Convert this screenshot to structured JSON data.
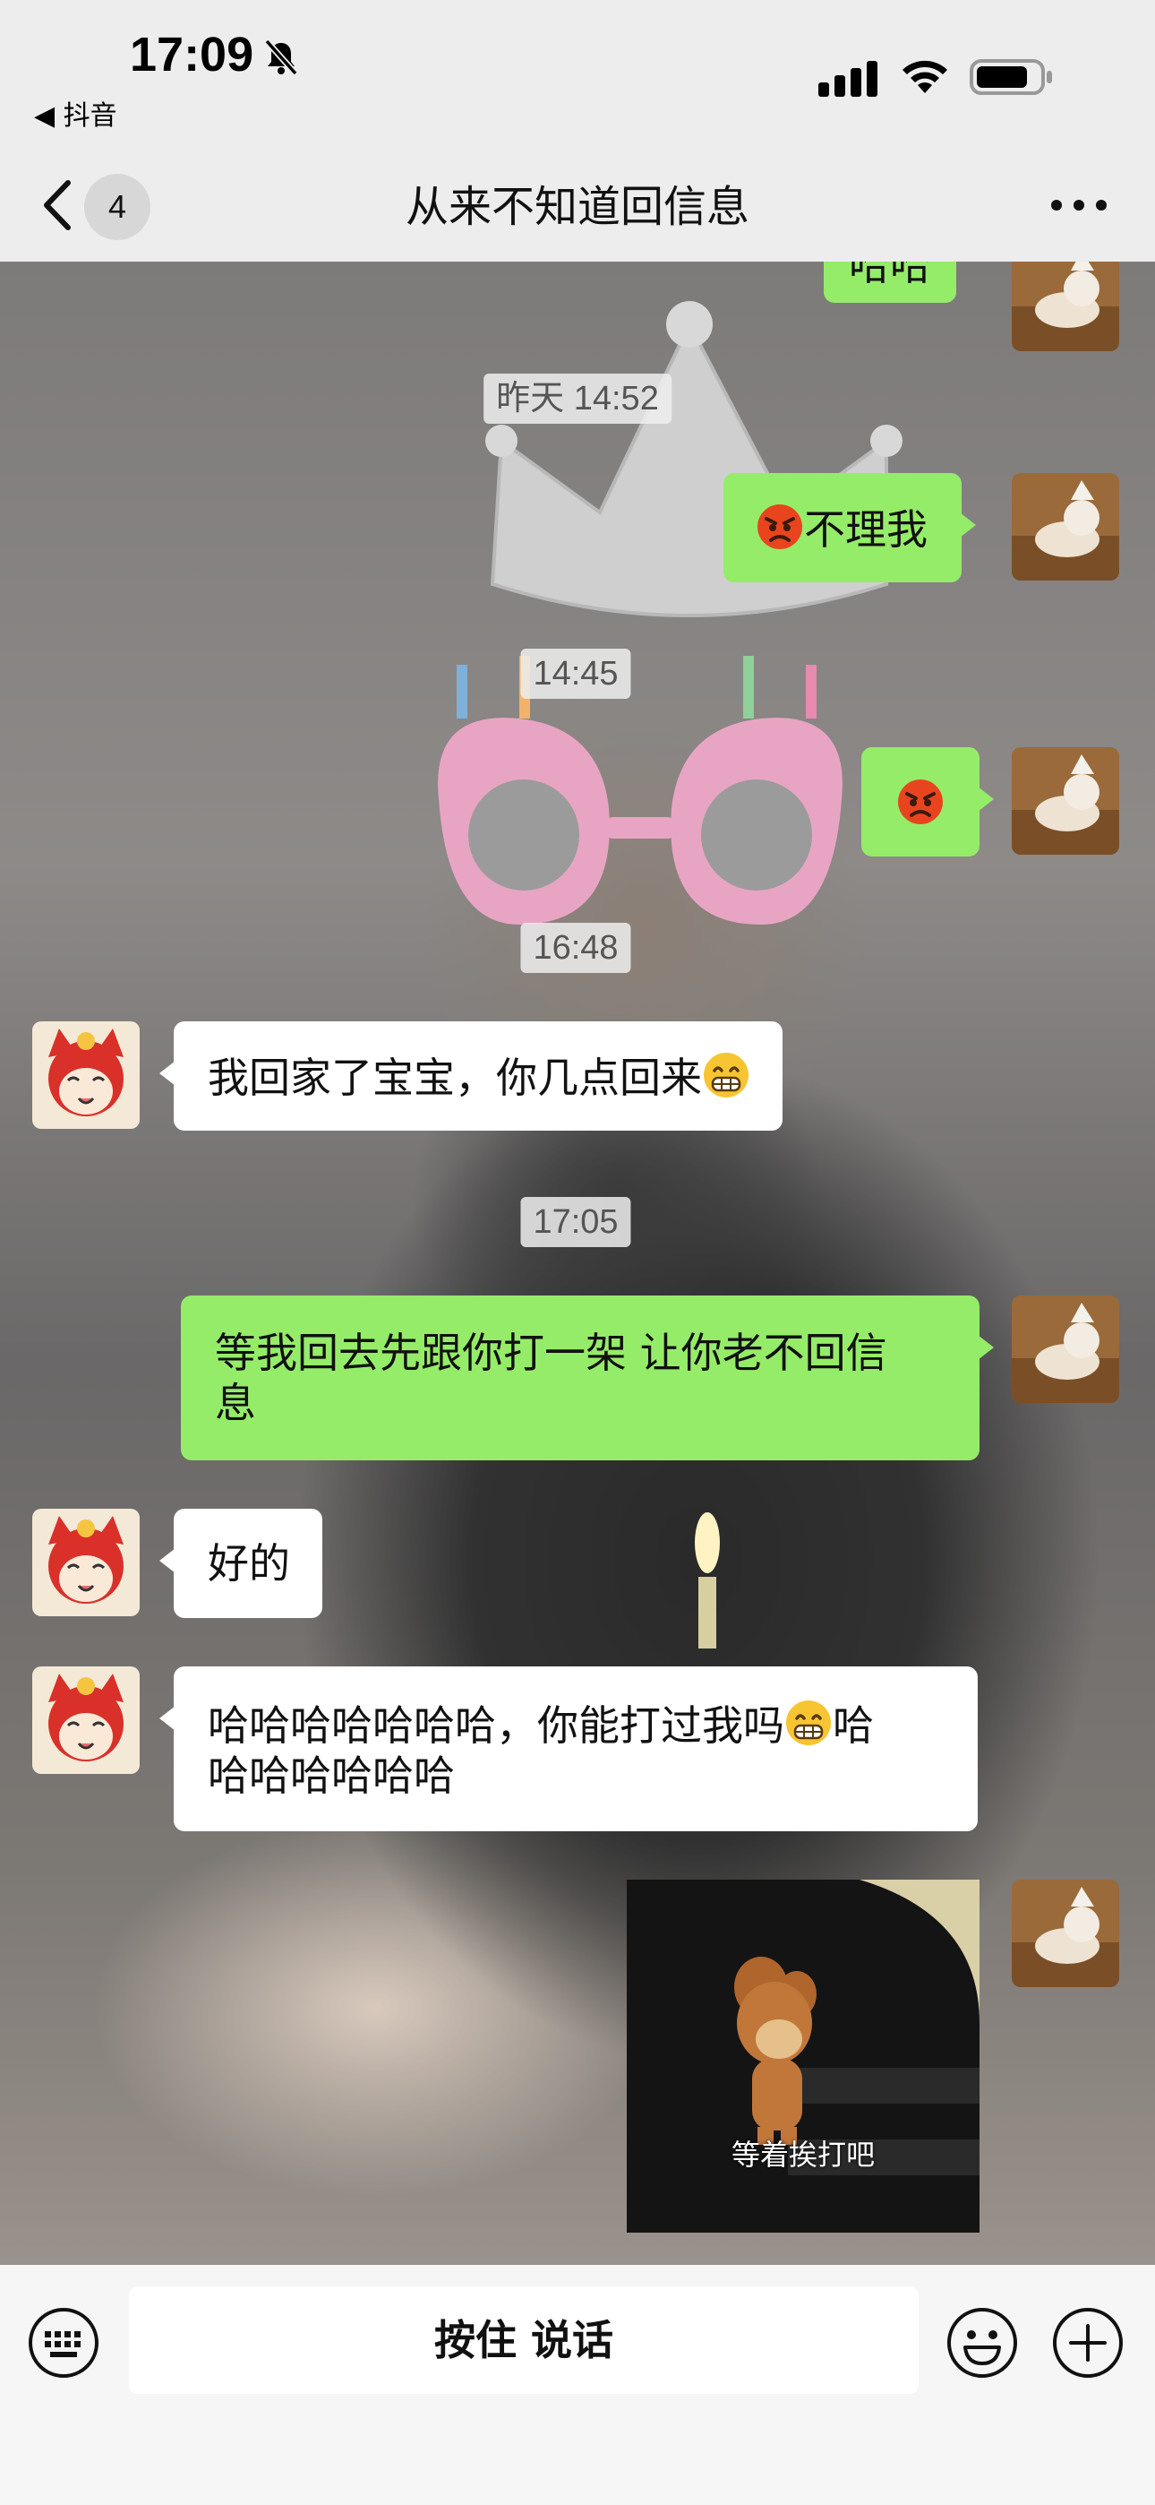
{
  "status_bar": {
    "time": "17:09",
    "back_app": "◀ 抖音"
  },
  "nav": {
    "unread_count": "4",
    "title": "从来不知道回信息"
  },
  "messages": [
    {
      "id": "m0",
      "type": "text",
      "from": "me",
      "text": "哈哈"
    },
    {
      "id": "t1",
      "type": "timestamp",
      "text": "昨天 14:52"
    },
    {
      "id": "m1",
      "type": "text",
      "from": "me",
      "emoji": "angry-emoji",
      "text": "不理我"
    },
    {
      "id": "t2",
      "type": "timestamp",
      "text": "14:45"
    },
    {
      "id": "m2",
      "type": "emoji",
      "from": "me",
      "emoji": "angry-emoji"
    },
    {
      "id": "t3",
      "type": "timestamp",
      "text": "16:48"
    },
    {
      "id": "m3",
      "type": "text",
      "from": "other",
      "text": "我回家了宝宝，你几点回来",
      "emoji_after": "grin-emoji"
    },
    {
      "id": "t4",
      "type": "timestamp",
      "text": "17:05"
    },
    {
      "id": "m4",
      "type": "text",
      "from": "me",
      "text_line1": "等我回去先跟你打一架 让你老不回信",
      "text_line2": "息"
    },
    {
      "id": "m5",
      "type": "text",
      "from": "other",
      "text": "好的"
    },
    {
      "id": "m6",
      "type": "text",
      "from": "other",
      "text_line1_a": "哈哈哈哈哈哈哈，你能打过我吗",
      "text_line1_b": "哈",
      "text_line2": "哈哈哈哈哈哈",
      "emoji_mid": "grin-emoji"
    },
    {
      "id": "m7",
      "type": "sticker",
      "from": "me",
      "caption": "等着挨打吧"
    }
  ],
  "input_bar": {
    "voice_label": "按住 说话"
  },
  "colors": {
    "my_bubble": "#95ec69",
    "their_bubble": "#ffffff",
    "bar_bg": "#ededed"
  }
}
